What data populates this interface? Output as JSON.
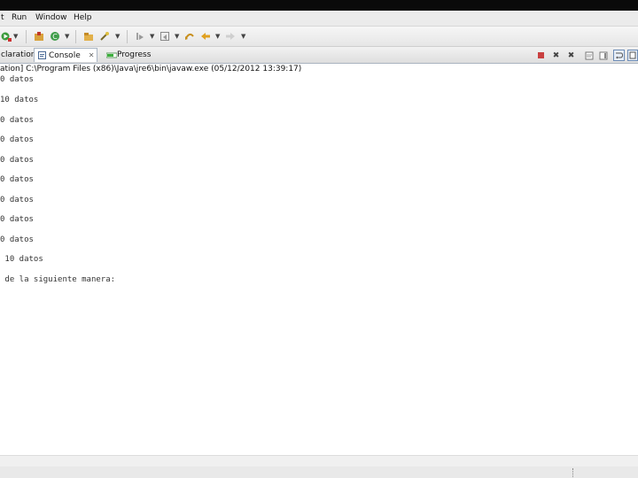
{
  "window": {
    "menu": [
      "t",
      "Run",
      "Window",
      "Help"
    ]
  },
  "toolbar": {
    "icons": [
      "run-icon",
      "dropdown-icon",
      "new-java-project-icon",
      "new-class-icon",
      "open-type-icon",
      "search-icon",
      "next-annotation-icon",
      "previous-annotation-icon",
      "last-edit-icon",
      "back-icon",
      "forward-icon"
    ]
  },
  "tabs": {
    "declaration": "claration",
    "console": "Console",
    "console_close": "✕",
    "progress": "Progress"
  },
  "console": {
    "header": "ation] C:\\Program Files (x86)\\Java\\jre6\\bin\\javaw.exe (05/12/2012 13:39:17)",
    "lines": [
      "0 datos",
      "10 datos",
      "0 datos",
      "0 datos",
      "0 datos",
      "0 datos",
      "0 datos",
      "0 datos",
      "0 datos",
      " 10 datos",
      " de la siguiente manera:"
    ]
  },
  "colors": {
    "accent": "#6c8bb5",
    "background": "#ffffff",
    "chrome": "#ebebeb"
  }
}
